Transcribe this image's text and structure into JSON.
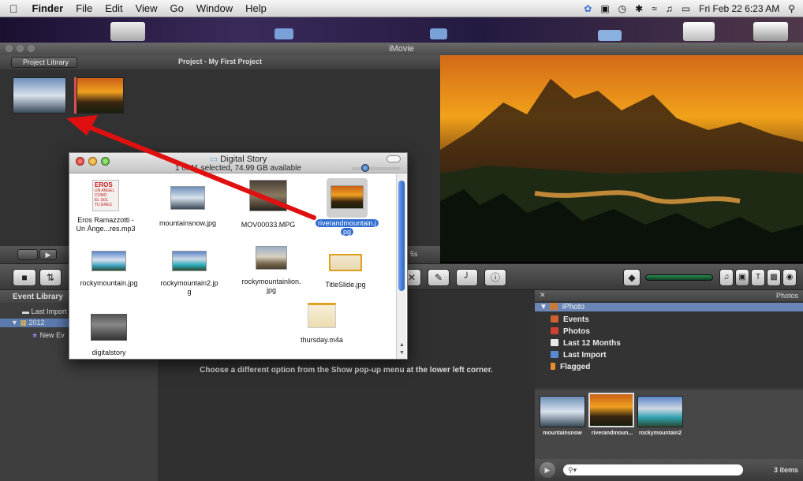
{
  "menubar": {
    "app_name": "Finder",
    "items": [
      "File",
      "Edit",
      "View",
      "Go",
      "Window",
      "Help"
    ],
    "clock": "Fri Feb 22  6:23 AM"
  },
  "imovie": {
    "window_title": "iMovie",
    "project_library_button": "Project Library",
    "project_title": "Project - My First Project",
    "duration_badge": "5s"
  },
  "event_library": {
    "header": "Event Library",
    "items": [
      "Last Import",
      "2012",
      "New Ev"
    ]
  },
  "event_browser": {
    "message": "Choose a different option from the Show pop-up menu at the lower left corner."
  },
  "photos_panel": {
    "header": "Photos",
    "sources": [
      "iPhoto",
      "Events",
      "Photos",
      "Last 12 Months",
      "Last Import",
      "Flagged"
    ],
    "thumbnails": [
      "mountainsnow",
      "riverandmoun...",
      "rockymountain2"
    ],
    "item_count": "3 items"
  },
  "finder": {
    "title": "Digital Story",
    "status": "1 of 11 selected, 74.99 GB available",
    "items": [
      {
        "name_line1": "Eros Ramazzotti -",
        "name_line2": "Un Ánge...res.mp3"
      },
      {
        "name_line1": "mountainsnow.jpg",
        "name_line2": ""
      },
      {
        "name_line1": "MOV00033.MPG",
        "name_line2": ""
      },
      {
        "name_line1": "riverandmountain.j",
        "name_line2": "pg"
      },
      {
        "name_line1": "rockymountain.jpg",
        "name_line2": ""
      },
      {
        "name_line1": "rockymountain2.jp",
        "name_line2": "g"
      },
      {
        "name_line1": "rockymountainlion.",
        "name_line2": "jpg"
      },
      {
        "name_line1": "TitleSlide.jpg",
        "name_line2": ""
      },
      {
        "name_line1": "digitalstory",
        "name_line2": ""
      },
      {
        "name_line1": "thursday.m4a",
        "name_line2": ""
      }
    ],
    "album_art_text": [
      "EROS",
      "UN ANGEL",
      "COMO",
      "EL SOL",
      "TU ERES"
    ]
  },
  "colors": {
    "accent_blue": "#2f6dd0",
    "annotation_arrow": "#e01010"
  }
}
